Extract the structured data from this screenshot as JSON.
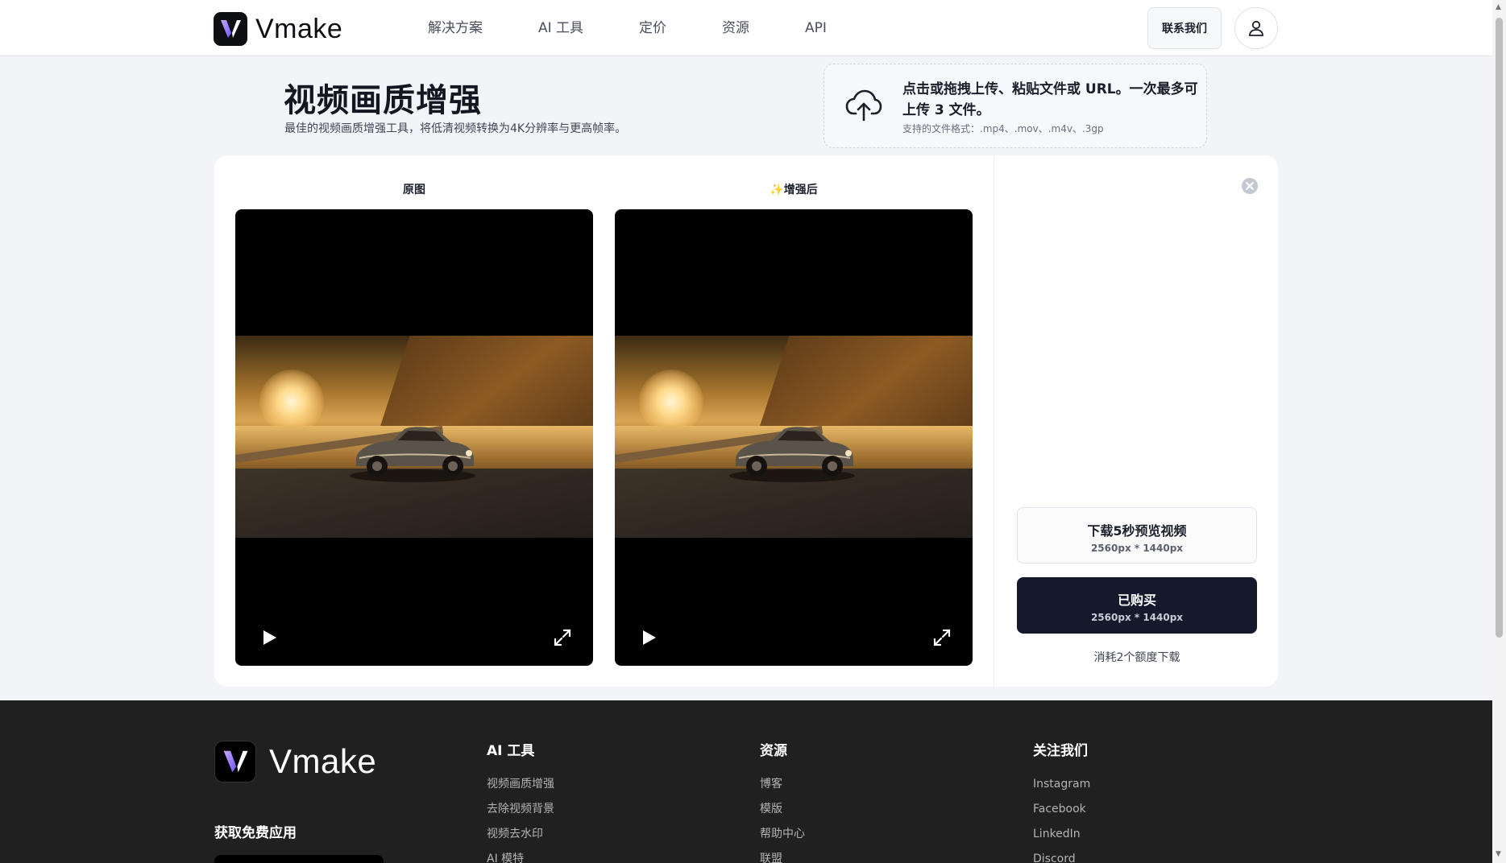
{
  "header": {
    "brand": "Vmake",
    "nav": [
      "解决方案",
      "AI 工具",
      "定价",
      "资源",
      "API"
    ],
    "contact_label": "联系我们",
    "user_icon": "user-icon"
  },
  "hero": {
    "title": "视频画质增强",
    "subtitle": "最佳的视频画质增强工具，将低清视频转换为4K分辨率与更高帧率。",
    "upload_text": "点击或拖拽上传、粘贴文件或 URL。一次最多可上传 3 文件。",
    "upload_formats": "支持的文件格式：.mp4、.mov、.m4v、.3gp",
    "upload_icon": "cloud-upload-icon"
  },
  "compare": {
    "original_label": "原图",
    "enhanced_label": "✨增强后"
  },
  "panel": {
    "preview_title": "下载5秒预览视频",
    "preview_size": "2560px * 1440px",
    "bought_title": "已购买",
    "bought_size": "2560px * 1440px",
    "credit_note": "消耗2个额度下载"
  },
  "footer": {
    "brand": "Vmake",
    "get_app": "获取免费应用",
    "columns": [
      {
        "title": "AI 工具",
        "links": [
          "视频画质增强",
          "去除视频背景",
          "视频去水印",
          "AI 模特"
        ]
      },
      {
        "title": "资源",
        "links": [
          "博客",
          "模版",
          "帮助中心",
          "联盟"
        ]
      },
      {
        "title": "关注我们",
        "links": [
          "Instagram",
          "Facebook",
          "LinkedIn",
          "Discord"
        ]
      }
    ]
  },
  "colors": {
    "accent_dark": "#141a2c",
    "footer_bg": "#202020",
    "page_bg": "#f2f4f8"
  }
}
